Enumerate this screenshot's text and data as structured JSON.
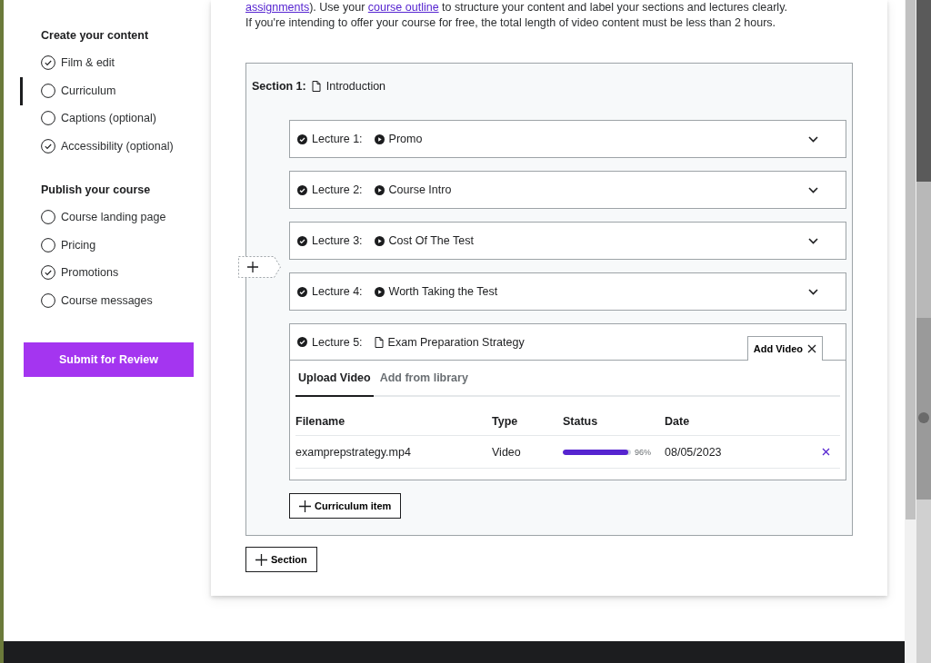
{
  "intro": [
    {
      "kind": "link",
      "text": "assignments"
    },
    {
      "kind": "text",
      "text": "). Use your "
    },
    {
      "kind": "link",
      "text": "course outline"
    },
    {
      "kind": "text",
      "text": " to structure your content and label your sections and lectures clearly. If you're intending to offer your course for free, the total length of video content must be less than 2 hours."
    }
  ],
  "sidebar": {
    "groups": [
      {
        "title": "Create your content",
        "items": [
          {
            "label": "Film & edit",
            "checked": true,
            "selected": false
          },
          {
            "label": "Curriculum",
            "checked": false,
            "selected": true
          },
          {
            "label": "Captions (optional)",
            "checked": false,
            "selected": false
          },
          {
            "label": "Accessibility (optional)",
            "checked": true,
            "selected": false
          }
        ]
      },
      {
        "title": "Publish your course",
        "items": [
          {
            "label": "Course landing page",
            "checked": false,
            "selected": false
          },
          {
            "label": "Pricing",
            "checked": false,
            "selected": false
          },
          {
            "label": "Promotions",
            "checked": true,
            "selected": false
          },
          {
            "label": "Course messages",
            "checked": false,
            "selected": false
          }
        ]
      }
    ],
    "submit": "Submit for Review"
  },
  "section": {
    "label": "Section 1:",
    "title": "Introduction",
    "kind": "article",
    "lectures": [
      {
        "label": "Lecture 1:",
        "title": "Promo",
        "kind": "video",
        "expanded": false
      },
      {
        "label": "Lecture 2:",
        "title": "Course Intro",
        "kind": "video",
        "expanded": false
      },
      {
        "label": "Lecture 3:",
        "title": "Cost Of The Test",
        "kind": "video",
        "expanded": false
      },
      {
        "label": "Lecture 4:",
        "title": "Worth Taking the Test",
        "kind": "video",
        "expanded": false
      },
      {
        "label": "Lecture 5:",
        "title": "Exam Preparation Strategy",
        "kind": "article",
        "expanded": true
      }
    ],
    "panel": {
      "tab_label": "Add Video",
      "tabs": [
        {
          "label": "Upload Video",
          "selected": true
        },
        {
          "label": "Add from library",
          "selected": false
        }
      ],
      "columns": [
        "Filename",
        "Type",
        "Status",
        "Date"
      ],
      "rows": [
        {
          "filename": "examprepstrategy.mp4",
          "type": "Video",
          "level": 0.96,
          "percent": "96%",
          "date": "08/05/2023"
        }
      ]
    },
    "add_item": "Curriculum item"
  },
  "add_section": "Section"
}
